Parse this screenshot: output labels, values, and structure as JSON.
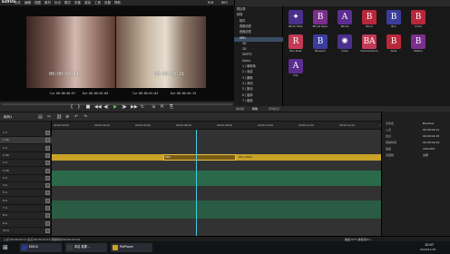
{
  "app": {
    "name": "EDIUS",
    "menu": [
      "文件",
      "编辑",
      "视图",
      "素材",
      "标记",
      "模式",
      "采集",
      "渲染",
      "工具",
      "设置",
      "帮助"
    ],
    "plr_label": "PLR",
    "rec_label": "REC"
  },
  "preview": {
    "left_timecode": "00:00:02:11",
    "right_timecode": "00:00:02:21",
    "left_cur_label": "Cur",
    "left_cur_value": "00:00:00:07",
    "left_dur_label": "Dur",
    "left_dur_value": "00:00:03:00",
    "right_cur_label": "Cur",
    "right_cur_value": "00:00:01:04",
    "right_dur_label": "Dur",
    "right_dur_value": "00:00:04:15"
  },
  "bin": {
    "tree": [
      "根目录",
      "转场",
      "软件",
      "视频滤镜",
      "音频滤镜",
      "GPU",
      "3D",
      "2D",
      "SMPTE",
      "Alpha",
      "1 / 硬转场",
      "2 / 渐变",
      "3 / 翻转",
      "4 / 滑动",
      "5 / 推动",
      "6 / 旋转",
      "7 / 缩放"
    ],
    "effects": [
      {
        "label": "Block Slide",
        "color": "#4a2f8c",
        "glyph": "✦"
      },
      {
        "label": "Blinds Open",
        "color": "#7a2f8c",
        "glyph": "B"
      },
      {
        "label": "Blinds",
        "color": "#5b2d90",
        "glyph": "A"
      },
      {
        "label": "Bend",
        "color": "#b8283a",
        "glyph": "B"
      },
      {
        "label": "Box",
        "color": "#3a3d9c",
        "glyph": "B"
      },
      {
        "label": "Circle",
        "color": "#b8283a",
        "glyph": "B"
      },
      {
        "label": "Box Slide",
        "color": "#c23a55",
        "glyph": "R"
      },
      {
        "label": "Blossom",
        "color": "#3a3d9c",
        "glyph": "B"
      },
      {
        "label": "Cube",
        "color": "#4a2f8c",
        "glyph": "✺"
      },
      {
        "label": "Double Doors",
        "color": "#c23a55",
        "glyph": "BA"
      },
      {
        "label": "Slide",
        "color": "#b8283a",
        "glyph": "B"
      },
      {
        "label": "Ribbon",
        "color": "#7a2f8c",
        "glyph": "B"
      },
      {
        "label": "Flip",
        "color": "#5b2d90",
        "glyph": "A"
      }
    ],
    "tabs": [
      "素材库",
      "特效",
      "序列标记"
    ]
  },
  "timeline": {
    "tab_label": "序列1",
    "tracks": [
      "1 V",
      "1 VA",
      "1 A",
      "2 VA",
      "2 A",
      "3 VA",
      "3 A",
      "4 A",
      "5 A",
      "6 A",
      "7 A",
      "8 A",
      "9 A",
      "10 A"
    ],
    "ruler": [
      "00:00:00:00",
      "00:00:02:00",
      "00:00:04:00",
      "00:00:06:00",
      "00:00:08:00",
      "00:00:10:00",
      "00:00:12:00",
      "00:00:14:00",
      "00:00:16:00"
    ],
    "clip_labels": [
      "002",
      "003_4K01"
    ]
  },
  "info": {
    "rows": [
      {
        "label": "文件名",
        "value": "Bianhua"
      },
      {
        "label": "入点",
        "value": "00:00:02:11"
      },
      {
        "label": "出点",
        "value": "00:00:04:15"
      },
      {
        "label": "持续时间",
        "value": "00:00:02:04"
      },
      {
        "label": "速度",
        "value": "100.00%"
      },
      {
        "label": "冻结帧",
        "value": "关闭"
      }
    ]
  },
  "status": {
    "left": "入点:00:00:02:11 出点:00:00:04:15 持续时间:00:00:02:04",
    "right": "磁盘:97% 被使用(C:)"
  },
  "taskbar": {
    "items": [
      {
        "label": "EDIUS",
        "color": "#2b3a8a"
      },
      {
        "label": "本站 录屏...",
        "color": "#3a3a3a"
      },
      {
        "label": "PotPlayer",
        "color": "#c9a227"
      }
    ],
    "time": "10:07",
    "date": "2020/11/19"
  }
}
